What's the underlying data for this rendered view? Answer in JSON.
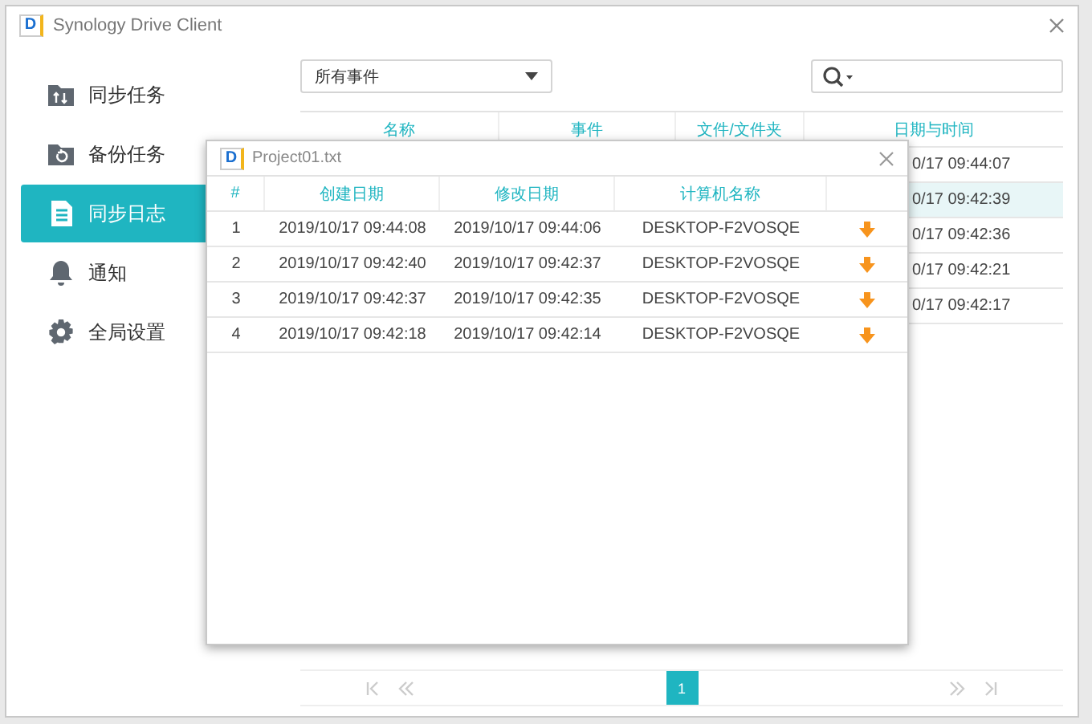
{
  "window": {
    "title": "Synology Drive Client",
    "logo_text": "D"
  },
  "sidebar": {
    "items": [
      {
        "label": "同步任务",
        "kind": "sync",
        "selected": false
      },
      {
        "label": "备份任务",
        "kind": "backup",
        "selected": false
      },
      {
        "label": "同步日志",
        "kind": "log",
        "selected": true
      },
      {
        "label": "通知",
        "kind": "notification",
        "selected": false
      },
      {
        "label": "全局设置",
        "kind": "settings",
        "selected": false
      }
    ]
  },
  "filter": {
    "value": "所有事件"
  },
  "table": {
    "columns": [
      "名称",
      "事件",
      "文件/文件夹",
      "日期与时间"
    ],
    "rows": [
      {
        "date": "0/17 09:44:07",
        "selected": false
      },
      {
        "date": "0/17 09:42:39",
        "selected": true
      },
      {
        "date": "0/17 09:42:36",
        "selected": false
      },
      {
        "date": "0/17 09:42:21",
        "selected": false
      },
      {
        "date": "0/17 09:42:17",
        "selected": false
      }
    ]
  },
  "pagination": {
    "pages": [
      {
        "label": "1",
        "selected": true
      }
    ],
    "first_disabled": true,
    "prev_disabled": true,
    "next_disabled": true,
    "last_disabled": true
  },
  "dialog": {
    "title": "Project01.txt",
    "logo_text": "D",
    "columns": [
      "#",
      "创建日期",
      "修改日期",
      "计算机名称"
    ],
    "rows": [
      {
        "index": "1",
        "created": "2019/10/17 09:44:08",
        "modified": "2019/10/17 09:44:06",
        "computer": "DESKTOP-F2VOSQE"
      },
      {
        "index": "2",
        "created": "2019/10/17 09:42:40",
        "modified": "2019/10/17 09:42:37",
        "computer": "DESKTOP-F2VOSQE"
      },
      {
        "index": "3",
        "created": "2019/10/17 09:42:37",
        "modified": "2019/10/17 09:42:35",
        "computer": "DESKTOP-F2VOSQE"
      },
      {
        "index": "4",
        "created": "2019/10/17 09:42:18",
        "modified": "2019/10/17 09:42:14",
        "computer": "DESKTOP-F2VOSQE"
      }
    ]
  }
}
